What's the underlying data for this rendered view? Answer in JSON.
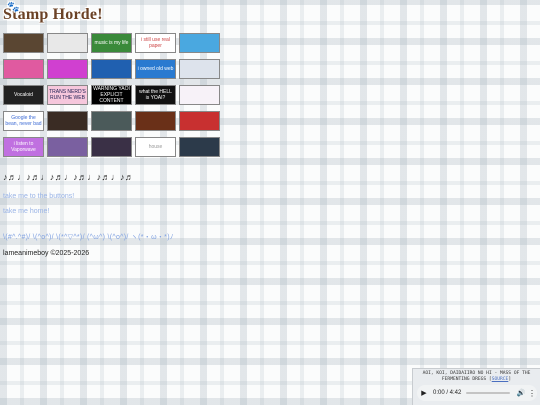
{
  "header": {
    "title": "Stamp Horde!"
  },
  "stamps": [
    {
      "text": "",
      "bg": "#5a4632",
      "fg": "#fff"
    },
    {
      "text": "",
      "bg": "#e8e8e8",
      "fg": "#222"
    },
    {
      "text": "music is my life",
      "bg": "#3a8a3a",
      "fg": "#fff"
    },
    {
      "text": "i still use real paper",
      "bg": "#ffffff",
      "fg": "#c44"
    },
    {
      "text": "",
      "bg": "#4aa8e0",
      "fg": "#fff"
    },
    {
      "text": "",
      "bg": "#e05aa0",
      "fg": "#fff"
    },
    {
      "text": "",
      "bg": "#d040d0",
      "fg": "#fff"
    },
    {
      "text": "",
      "bg": "#2060b0",
      "fg": "#fff"
    },
    {
      "text": "i owned old web",
      "bg": "#2a7ad0",
      "fg": "#fff"
    },
    {
      "text": "",
      "bg": "#dde3ec",
      "fg": "#222"
    },
    {
      "text": "Vocaloid",
      "bg": "#222222",
      "fg": "#fff"
    },
    {
      "text": "TRANS NERD'S RUN THE WEB",
      "bg": "#f6c7dc",
      "fg": "#225"
    },
    {
      "text": "WARNING YAOI EXPLICIT CONTENT",
      "bg": "#000000",
      "fg": "#fff"
    },
    {
      "text": "what the HELL is YOAI?",
      "bg": "#111111",
      "fg": "#fff"
    },
    {
      "text": "",
      "bg": "#f7f2f8",
      "fg": "#888"
    },
    {
      "text": "Google the bean, never bad",
      "bg": "#ffffff",
      "fg": "#3c6ad4"
    },
    {
      "text": "",
      "bg": "#3a2c24",
      "fg": "#fff"
    },
    {
      "text": "",
      "bg": "#4b5a5a",
      "fg": "#fff"
    },
    {
      "text": "",
      "bg": "#6a3018",
      "fg": "#fff"
    },
    {
      "text": "",
      "bg": "#c83030",
      "fg": "#fff"
    },
    {
      "text": "i listen to Vaporwave",
      "bg": "#c070e0",
      "fg": "#fff"
    },
    {
      "text": "",
      "bg": "#7a60a0",
      "fg": "#fff"
    },
    {
      "text": "",
      "bg": "#3a3046",
      "fg": "#fff"
    },
    {
      "text": "house",
      "bg": "#ffffff",
      "fg": "#999"
    },
    {
      "text": "",
      "bg": "#2c3a4a",
      "fg": "#fff"
    }
  ],
  "symbols": "♪♬♩♪♬♩♪♬♩♪♬♩♪♬♩♪♬",
  "links": {
    "buttons": "take me to the buttons!",
    "home": "take me home!"
  },
  "kaomoji": "\\(#^.^#)/ \\(^o^)/ \\(*^▽^*)/ (^ω^) \\(^o^)/ ヽ(*・ω・*)ﾉ",
  "footer": {
    "copyright": "lameanimeboy ©2025-2026"
  },
  "player": {
    "now_playing": "AOI, KOI, DAIDAIIRO NO HI - MASS OF THE FERMENTING DREGS",
    "source_label": "source",
    "play_icon": "play-icon",
    "time": "0:00 / 4:42",
    "progress": 0,
    "volume_icon": "volume-icon",
    "menu_icon": "more-vertical-icon"
  }
}
